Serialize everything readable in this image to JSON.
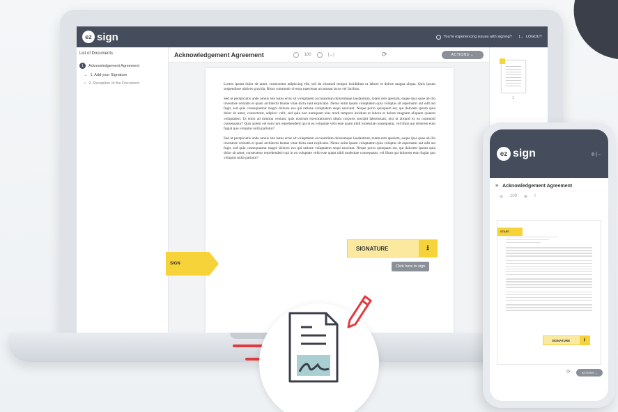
{
  "app": {
    "logo_prefix": "ez",
    "logo_text": "sign",
    "issue_text": "You're experiencing issues with signing?",
    "logout_label": "LOGOUT"
  },
  "sidebar": {
    "header": "List of Documents",
    "document": {
      "number": "1",
      "label": "Acknowledgement Agreement"
    },
    "steps": [
      {
        "label": "1. Add your Signature"
      },
      {
        "label": "2. Reception of the Document"
      }
    ]
  },
  "main": {
    "title": "Acknowledgement Agreement",
    "zoom": "100",
    "actions_label": "ACTIONS",
    "paragraphs": [
      "Lorem ipsum dolor sit amet, consectetur adipiscing elit, sed do eiusmod tempor incididunt ut labore et dolore magna aliqua. Quis ipsum suspendisse ultrices gravida. Risus commodo viverra maecenas accumsan lacus vel facilisis.",
      "Sed ut perspiciatis unde omnis iste natus error sit voluptatem accusantium doloremque laudantium, totam rem aperiam, eaque ipsa quae ab illo inventore veritatis et quasi architecto beatae vitae dicta sunt explicabo. Nemo enim ipsam voluptatem quia voluptas sit aspernatur aut odit aut fugit, sed quia consequuntur magni dolores eos qui ratione voluptatem sequi nesciunt. Neque porro quisquam est, qui dolorem ipsum quia dolor sit amet, consectetur, adipisci velit, sed quia non numquam eius modi tempora incidunt ut labore et dolore magnam aliquam quaerat voluptatem. Ut enim ad minima veniam, quis nostrum exercitationem ullam corporis suscipit laboriosam, nisi ut aliquid ex ea commodi consequatur? Quis autem vel eum iure reprehenderit qui in ea voluptate velit esse quam nihil molestiae consequatur, vel illum qui dolorem eum fugiat quo voluptas nulla pariatur?",
      "Sed ut perspiciatis unde omnis iste natus error sit voluptatem accusantium doloremque laudantium, totam rem aperiam, eaque ipsa quae ab illo inventore veritatis et quasi architecto beatae vitae dicta sunt explicabo. Nemo enim ipsam voluptatem quia voluptas sit aspernatur aut odit aut fugit, sed quia consequuntur magni dolores eos qui ratione voluptatem sequi nesciunt. Neque porro quisquam est, qui dolorem ipsum quia dolor sit amet, consectetur reprehenderit qui in ea voluptate velit esse quam nihil molestiae consequatur, vel illum qui dolorem eum fugiat quo voluptas nulla pariatur?"
    ],
    "sign_tag": "SIGN",
    "signature_label": "SIGNATURE",
    "tooltip": "Click here to sign",
    "thumb_page": "1"
  },
  "phone": {
    "title": "Acknowledgement Agreement",
    "zoom": "100",
    "sign_tag": "START",
    "signature_label": "SIGNATURE",
    "actions_label": "ACTIONS"
  },
  "icons": {
    "download": "download-icon",
    "refresh": "refresh-icon",
    "document_sign": "document-sign-icon",
    "pen": "pen-icon"
  },
  "colors": {
    "topbar": "#454c5c",
    "accent_yellow": "#f7d33a",
    "signature_fill": "#fbe9a0",
    "action_gray": "#8b9098",
    "brand_red": "#e23b3f",
    "signature_teal": "#a9cfd3"
  }
}
